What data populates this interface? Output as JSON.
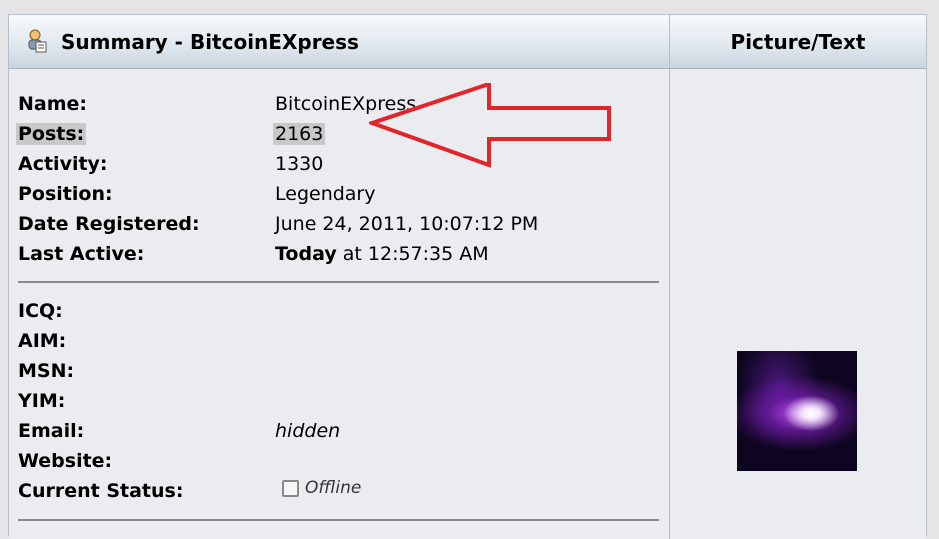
{
  "header": {
    "icon": "user-summary-icon",
    "title": "Summary - BitcoinEXpress",
    "right_title": "Picture/Text"
  },
  "profile": {
    "name_label": "Name:",
    "name_value": "BitcoinEXpress",
    "posts_label": "Posts:",
    "posts_value": "2163",
    "activity_label": "Activity:",
    "activity_value": "1330",
    "position_label": "Position:",
    "position_value": "Legendary",
    "registered_label": "Date Registered:",
    "registered_value": "June 24, 2011, 10:07:12 PM",
    "last_active_label": "Last Active:",
    "last_active_today": "Today",
    "last_active_rest": " at 12:57:35 AM"
  },
  "contact": {
    "icq_label": "ICQ:",
    "aim_label": "AIM:",
    "msn_label": "MSN:",
    "yim_label": "YIM:",
    "email_label": "Email:",
    "email_value": "hidden",
    "website_label": "Website:",
    "status_label": "Current Status:",
    "status_value": "Offline"
  },
  "colors": {
    "annotation_arrow": "#e0262b",
    "posts_highlight": "#c8c8c8"
  }
}
